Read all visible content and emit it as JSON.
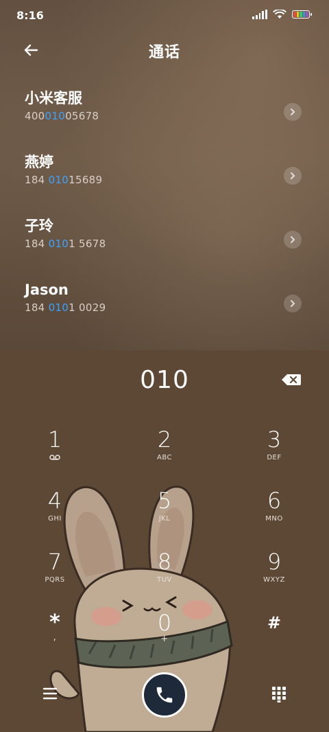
{
  "status_bar": {
    "time": "8:16"
  },
  "header": {
    "title": "通话"
  },
  "contacts": [
    {
      "name": "小米客服",
      "number_pre": "400",
      "number_hl": "010",
      "number_post": "05678"
    },
    {
      "name": "燕婷",
      "number_pre": "184 ",
      "number_hl": "010",
      "number_post": "15689"
    },
    {
      "name": "子玲",
      "number_pre": "184 ",
      "number_hl": "010",
      "number_post": "1 5678"
    },
    {
      "name": "Jason",
      "number_pre": "184 ",
      "number_hl": "010",
      "number_post": "1 0029"
    }
  ],
  "dialer": {
    "input": "010"
  },
  "keys": [
    {
      "digit": "1",
      "sub": ""
    },
    {
      "digit": "2",
      "sub": "ABC"
    },
    {
      "digit": "3",
      "sub": "DEF"
    },
    {
      "digit": "4",
      "sub": "GHI"
    },
    {
      "digit": "5",
      "sub": "JKL"
    },
    {
      "digit": "6",
      "sub": "MNO"
    },
    {
      "digit": "7",
      "sub": "PQRS"
    },
    {
      "digit": "8",
      "sub": "TUV"
    },
    {
      "digit": "9",
      "sub": "WXYZ"
    },
    {
      "digit": "*",
      "sub": ","
    },
    {
      "digit": "0",
      "sub": "+"
    },
    {
      "digit": "#",
      "sub": ""
    }
  ],
  "icons": {
    "voicemail": "voicemail-icon",
    "back": "arrow-left-icon",
    "backspace": "backspace-icon",
    "call": "phone-icon",
    "menu": "menu-icon",
    "keypad": "dialpad-icon"
  },
  "colors": {
    "highlight": "#3ba3ff",
    "call_button": "#1e2a3a"
  }
}
